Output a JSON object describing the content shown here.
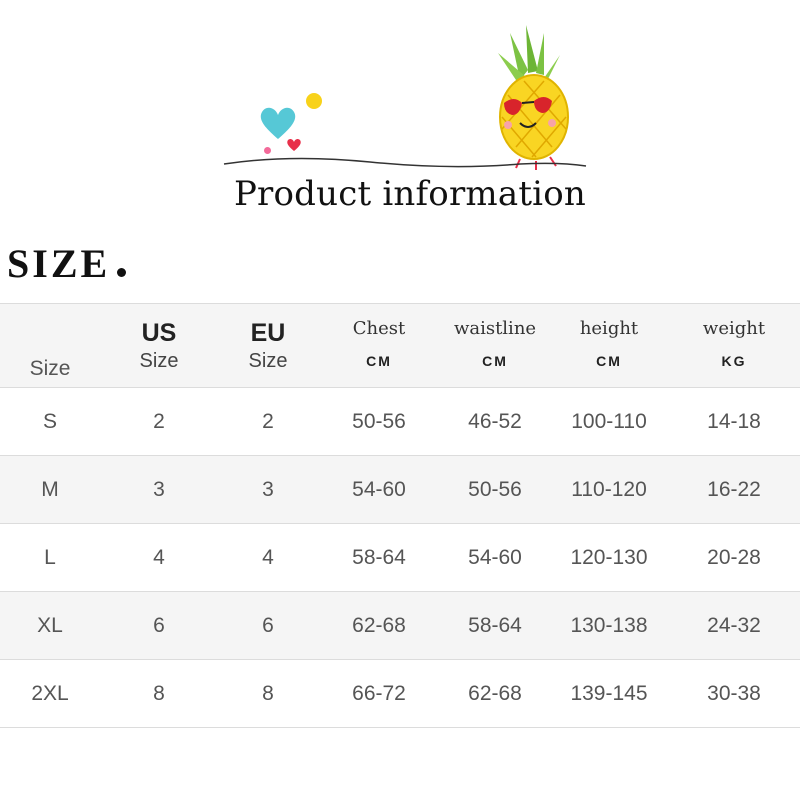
{
  "banner": {
    "title": "Product information"
  },
  "section": {
    "heading": "SIZE"
  },
  "table": {
    "headers": [
      {
        "top": "",
        "bottom": "Size"
      },
      {
        "top": "US",
        "bottom": "Size"
      },
      {
        "top": "EU",
        "bottom": "Size"
      },
      {
        "top": "Chest",
        "bottom": "CM"
      },
      {
        "top": "waistline",
        "bottom": "CM"
      },
      {
        "top": "height",
        "bottom": "CM"
      },
      {
        "top": "weight",
        "bottom": "KG"
      }
    ],
    "rows": [
      [
        "S",
        "2",
        "2",
        "50-56",
        "46-52",
        "100-110",
        "14-18"
      ],
      [
        "M",
        "3",
        "3",
        "54-60",
        "50-56",
        "110-120",
        "16-22"
      ],
      [
        "L",
        "4",
        "4",
        "58-64",
        "54-60",
        "120-130",
        "20-28"
      ],
      [
        "XL",
        "6",
        "6",
        "62-68",
        "58-64",
        "130-138",
        "24-32"
      ],
      [
        "2XL",
        "8",
        "8",
        "66-72",
        "62-68",
        "139-145",
        "30-38"
      ]
    ]
  },
  "colors": {
    "heart": "#56c8d6",
    "sun_dot": "#f8d21a",
    "accent_pink": "#f36a9a",
    "pineapple_body": "#f9d523",
    "pineapple_leaves": "#7cc243",
    "sunglasses": "#d8242b",
    "row_shade": "#f5f5f5",
    "divider": "#dcdcdc"
  },
  "icons": [
    "heart-icon",
    "pineapple-icon",
    "small-heart-icon"
  ]
}
